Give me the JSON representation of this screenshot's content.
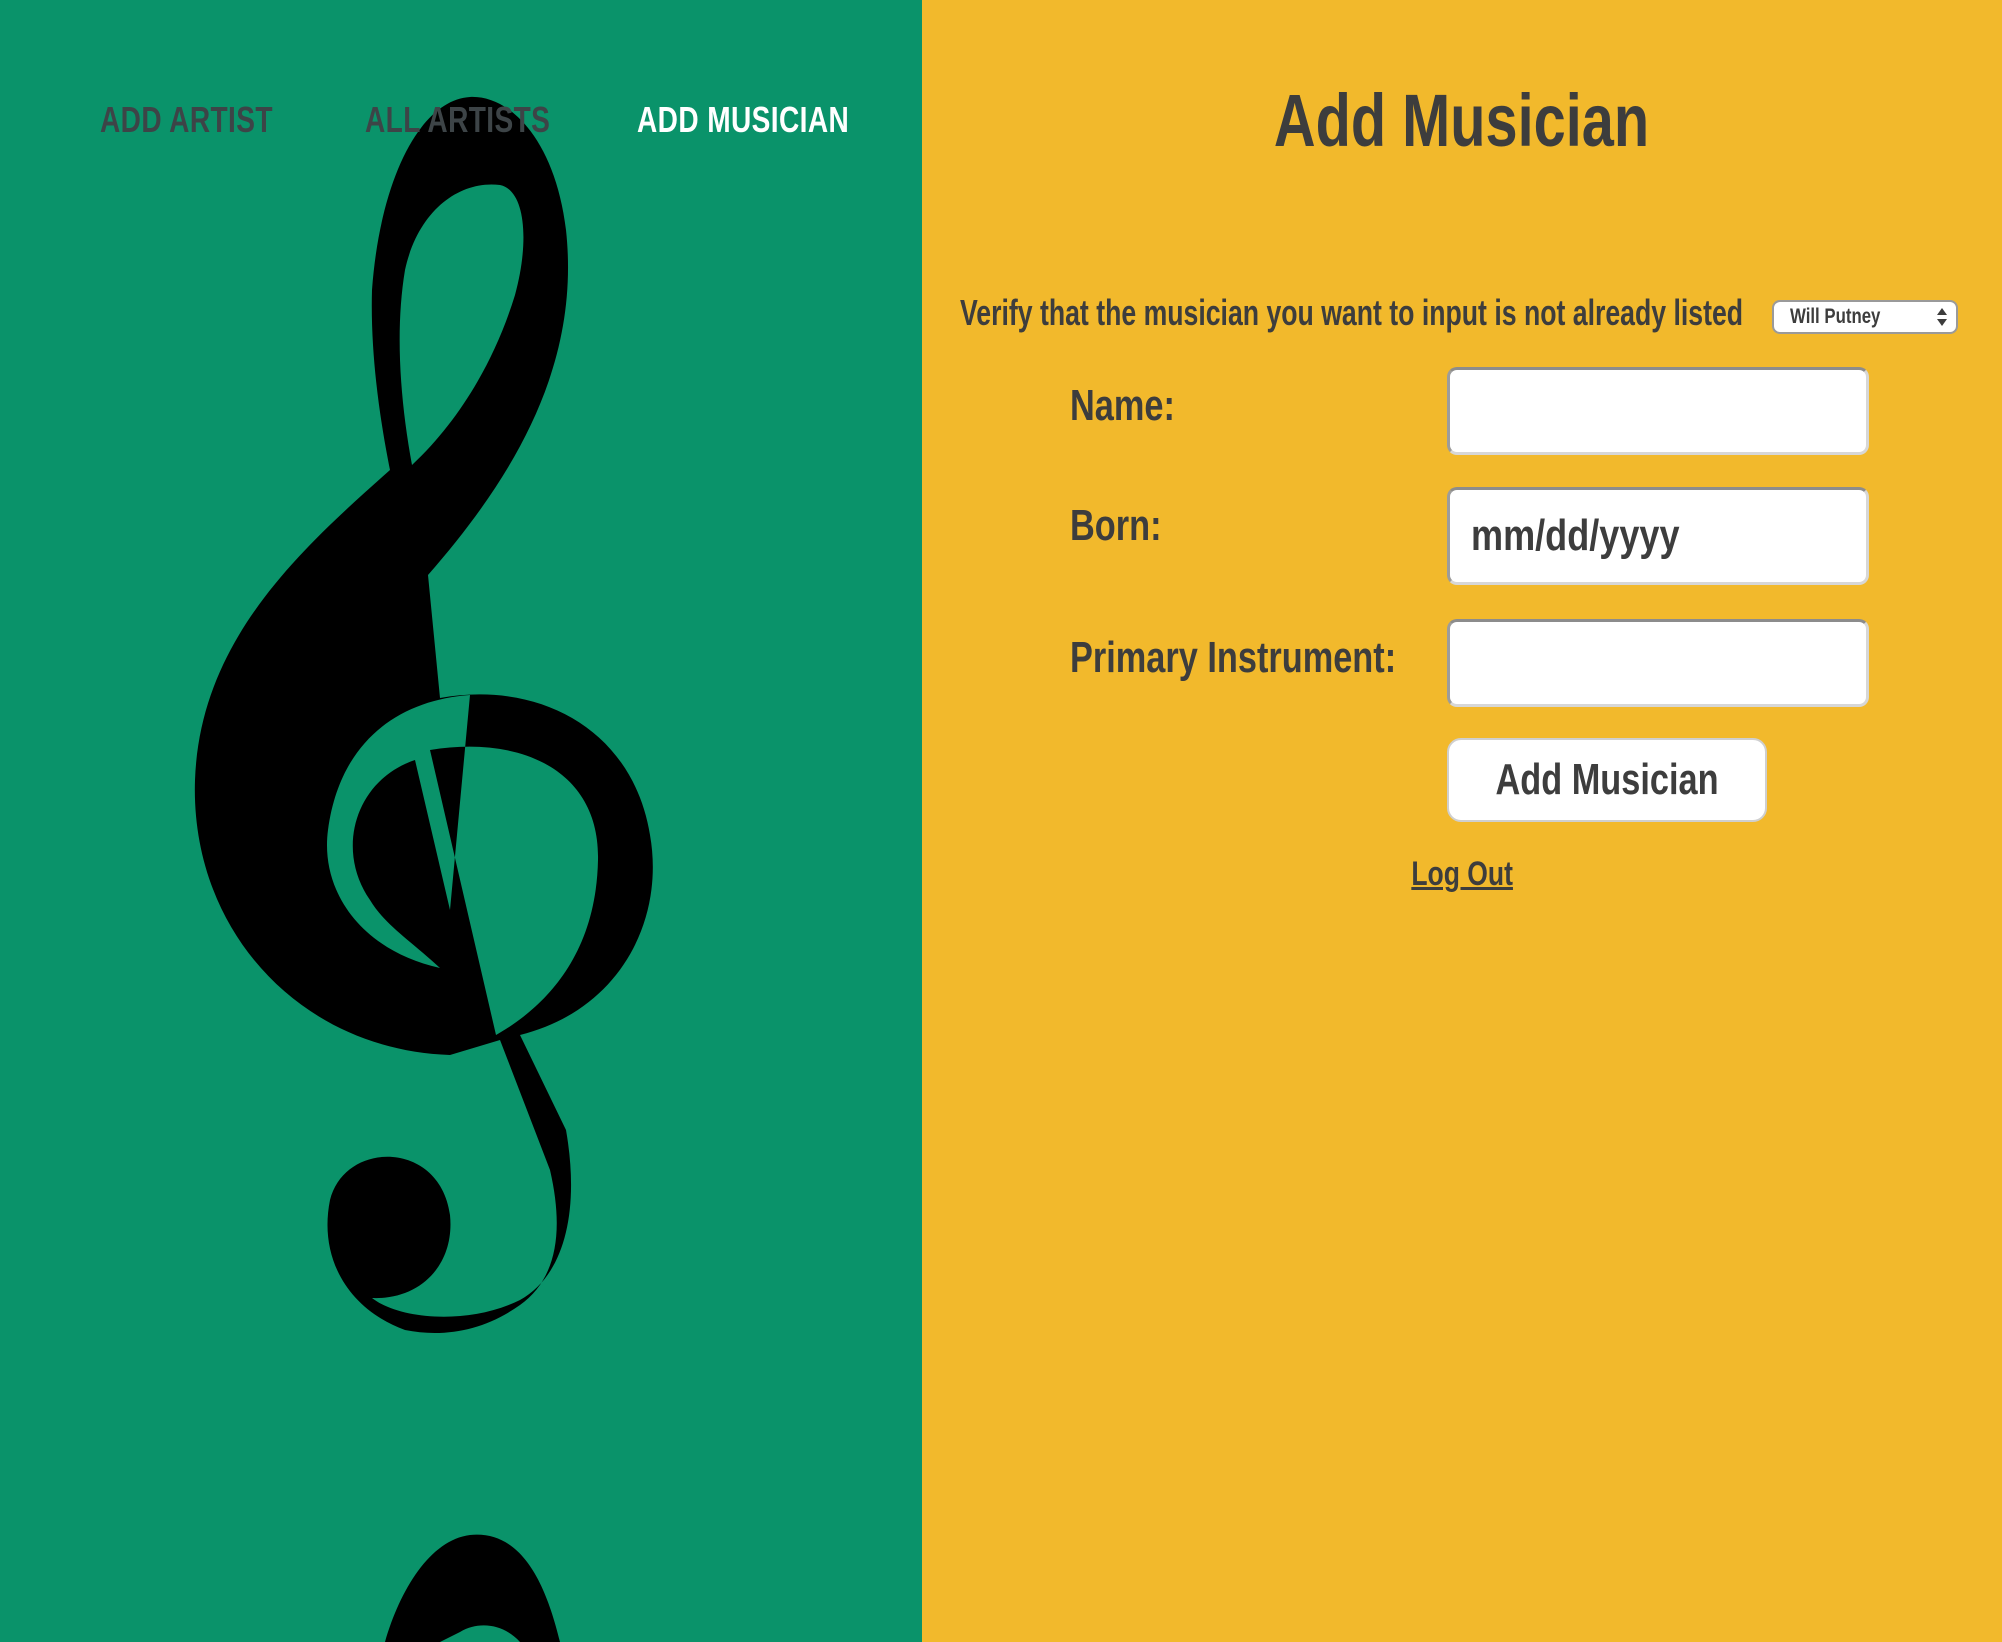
{
  "nav": {
    "items": [
      {
        "label": "ADD ARTIST",
        "active": false
      },
      {
        "label": "ALL ARTISTS",
        "active": false
      },
      {
        "label": "ADD MUSICIAN",
        "active": true
      }
    ]
  },
  "colors": {
    "left_panel_bg": "#0a936a",
    "right_panel_bg": "#f2b92c",
    "text": "#3d3d3d",
    "nav_active": "#ffffff"
  },
  "decoration": {
    "icon": "treble-clef-icon"
  },
  "main": {
    "title": "Add Musician",
    "verify": {
      "text": "Verify that the musician you want to input is not already listed",
      "selected": "Will Putney"
    },
    "form": {
      "name_label": "Name:",
      "name_value": "",
      "born_label": "Born:",
      "born_placeholder": "mm/dd/yyyy",
      "instrument_label": "Primary Instrument:",
      "instrument_value": "",
      "submit_label": "Add Musician"
    },
    "logout_label": "Log Out"
  }
}
